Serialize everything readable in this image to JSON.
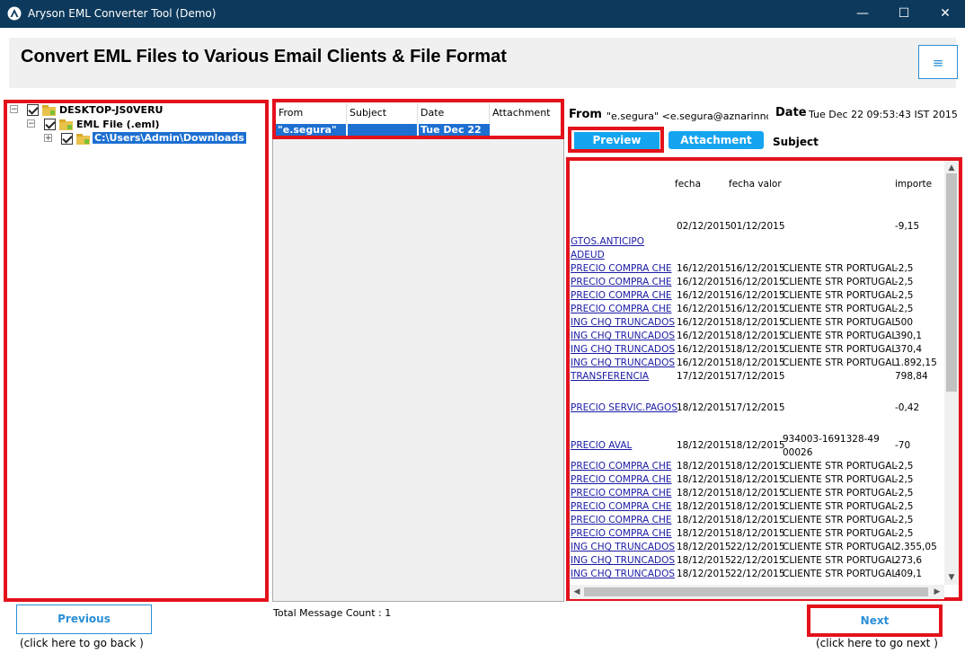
{
  "window": {
    "title": "Aryson EML Converter Tool (Demo)",
    "minimize": "—",
    "maximize": "☐",
    "close": "✕"
  },
  "header": {
    "title": "Convert EML Files to Various Email Clients & File Format",
    "menu_icon": "≡"
  },
  "tree": {
    "root": "DESKTOP-JS0VERU",
    "child": "EML File (.eml)",
    "leaf": "C:\\Users\\Admin\\Downloads"
  },
  "message_list": {
    "columns": [
      "From",
      "Subject",
      "Date",
      "Attachment"
    ],
    "rows": [
      {
        "from": "\"e.segura\"",
        "subject": "",
        "date": "Tue Dec 22",
        "attachment": ""
      }
    ],
    "total_count": "Total Message Count : 1"
  },
  "message": {
    "from_label": "From",
    "from_value": "\"e.segura\" <e.segura@aznarinnov...",
    "date_label": "Date",
    "date_value": "Tue Dec 22 09:53:43 IST 2015",
    "preview_tab": "Preview",
    "attachment_tab": "Attachment",
    "subject_label": "Subject"
  },
  "preview": {
    "glyph": "",
    "headers": {
      "fecha": "fecha",
      "fecha_valor": "fecha valor",
      "importe": "importe"
    },
    "first_row": {
      "fecha": "02/12/2015",
      "fecha_valor": "01/12/2015",
      "importe": "-9,15"
    },
    "link_only": [
      "GTOS.ANTICIPO",
      "ADEUD"
    ],
    "rows": [
      {
        "concept": "PRECIO COMPRA CHE",
        "fecha": "16/12/2015",
        "valor": "16/12/2015",
        "desc": "CLIENTE STR PORTUGAL",
        "importe": "-2,5"
      },
      {
        "concept": "PRECIO COMPRA CHE",
        "fecha": "16/12/2015",
        "valor": "16/12/2015",
        "desc": "CLIENTE STR PORTUGAL",
        "importe": "-2,5"
      },
      {
        "concept": "PRECIO COMPRA CHE",
        "fecha": "16/12/2015",
        "valor": "16/12/2015",
        "desc": "CLIENTE STR PORTUGAL",
        "importe": "-2,5"
      },
      {
        "concept": "PRECIO COMPRA CHE",
        "fecha": "16/12/2015",
        "valor": "16/12/2015",
        "desc": "CLIENTE STR PORTUGAL",
        "importe": "-2,5"
      },
      {
        "concept": "ING CHQ TRUNCADOS",
        "fecha": "16/12/2015",
        "valor": "18/12/2015",
        "desc": "CLIENTE STR PORTUGAL",
        "importe": "500"
      },
      {
        "concept": "ING CHQ TRUNCADOS",
        "fecha": "16/12/2015",
        "valor": "18/12/2015",
        "desc": "CLIENTE STR PORTUGAL",
        "importe": "390,1"
      },
      {
        "concept": "ING CHQ TRUNCADOS",
        "fecha": "16/12/2015",
        "valor": "18/12/2015",
        "desc": "CLIENTE STR PORTUGAL",
        "importe": "370,4"
      },
      {
        "concept": "ING CHQ TRUNCADOS",
        "fecha": "16/12/2015",
        "valor": "18/12/2015",
        "desc": "CLIENTE STR PORTUGAL",
        "importe": "1.892,15"
      },
      {
        "concept": "TRANSFERENCIA",
        "fecha": "17/12/2015",
        "valor": "17/12/2015",
        "desc": "",
        "importe": "798,84"
      }
    ],
    "servic_row": {
      "concept": "PRECIO SERVIC.PAGOS",
      "fecha": "18/12/2015",
      "valor": "17/12/2015",
      "importe": "-0,42"
    },
    "aval_row": {
      "concept": "PRECIO AVAL",
      "fecha": "18/12/2015",
      "valor": "18/12/2015",
      "desc1": "934003-1691328-49",
      "desc2": "00026",
      "importe": "-70"
    },
    "rows2": [
      {
        "concept": "PRECIO COMPRA CHE",
        "fecha": "18/12/2015",
        "valor": "18/12/2015",
        "desc": "CLIENTE STR PORTUGAL",
        "importe": "-2,5"
      },
      {
        "concept": "PRECIO COMPRA CHE",
        "fecha": "18/12/2015",
        "valor": "18/12/2015",
        "desc": "CLIENTE STR PORTUGAL",
        "importe": "-2,5"
      },
      {
        "concept": "PRECIO COMPRA CHE",
        "fecha": "18/12/2015",
        "valor": "18/12/2015",
        "desc": "CLIENTE STR PORTUGAL",
        "importe": "-2,5"
      },
      {
        "concept": "PRECIO COMPRA CHE",
        "fecha": "18/12/2015",
        "valor": "18/12/2015",
        "desc": "CLIENTE STR PORTUGAL",
        "importe": "-2,5"
      },
      {
        "concept": "PRECIO COMPRA CHE",
        "fecha": "18/12/2015",
        "valor": "18/12/2015",
        "desc": "CLIENTE STR PORTUGAL",
        "importe": "-2,5"
      },
      {
        "concept": "PRECIO COMPRA CHE",
        "fecha": "18/12/2015",
        "valor": "18/12/2015",
        "desc": "CLIENTE STR PORTUGAL",
        "importe": "-2,5"
      },
      {
        "concept": "ING CHQ TRUNCADOS",
        "fecha": "18/12/2015",
        "valor": "22/12/2015",
        "desc": "CLIENTE STR PORTUGAL",
        "importe": "2.355,05"
      },
      {
        "concept": "ING CHQ TRUNCADOS",
        "fecha": "18/12/2015",
        "valor": "22/12/2015",
        "desc": "CLIENTE STR PORTUGAL",
        "importe": "273,6"
      },
      {
        "concept": "ING CHQ TRUNCADOS",
        "fecha": "18/12/2015",
        "valor": "22/12/2015",
        "desc": "CLIENTE STR PORTUGAL",
        "importe": "409,1"
      }
    ]
  },
  "nav": {
    "previous": "Previous",
    "previous_hint": "(click here to  go back )",
    "next": "Next",
    "next_hint": "(click here to  go next )"
  },
  "colors": {
    "titlebar": "#0d3a5c",
    "highlight": "#e3121b",
    "accent": "#15a4ef",
    "selection": "#1d6fd1",
    "link": "#1a1aa6"
  }
}
